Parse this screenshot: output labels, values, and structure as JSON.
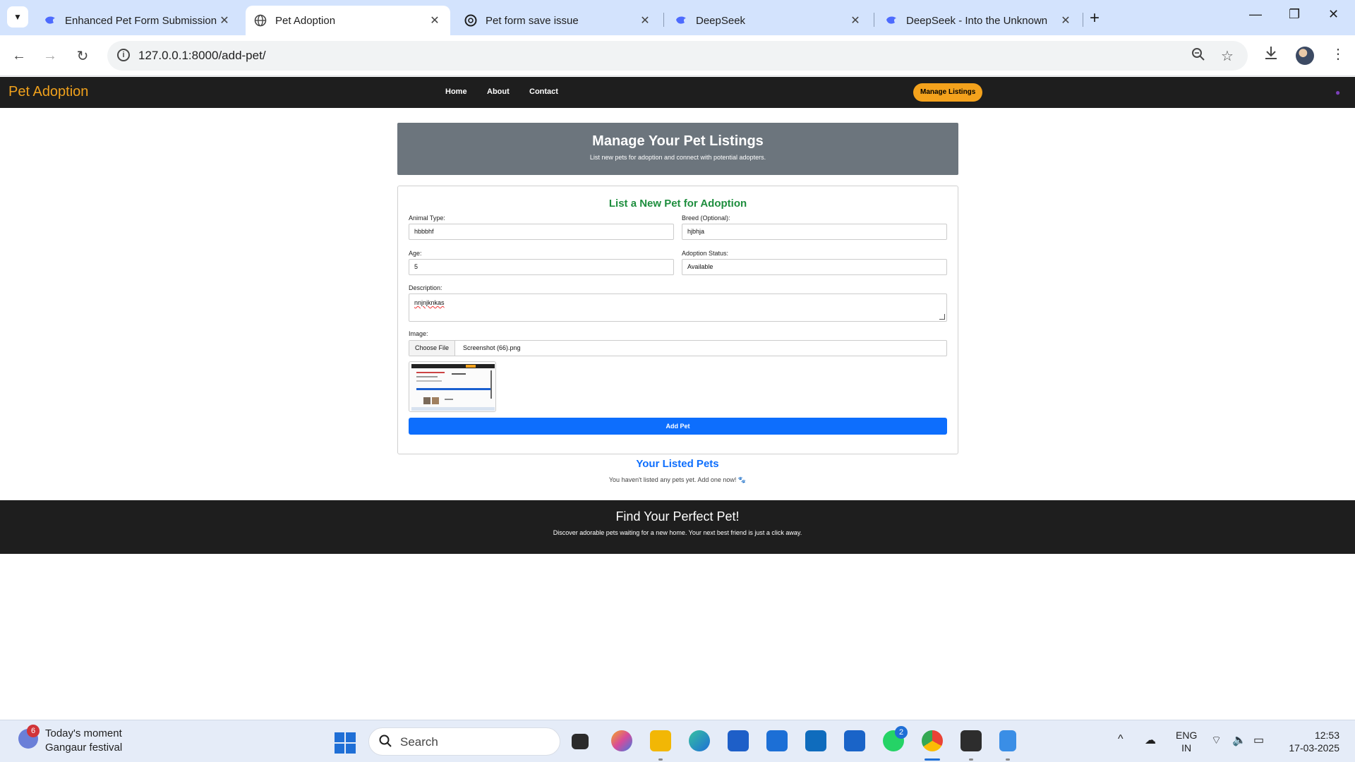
{
  "browser": {
    "tabs": [
      {
        "title": "Enhanced Pet Form Submission",
        "active": false,
        "icon": "deepseek-icon"
      },
      {
        "title": "Pet Adoption",
        "active": true,
        "icon": "globe-icon"
      },
      {
        "title": "Pet form save issue",
        "active": false,
        "icon": "chatgpt-icon"
      },
      {
        "title": "DeepSeek",
        "active": false,
        "icon": "deepseek-icon"
      },
      {
        "title": "DeepSeek - Into the Unknown",
        "active": false,
        "icon": "deepseek-icon"
      }
    ],
    "url": "127.0.0.1:8000/add-pet/"
  },
  "site": {
    "brand": "Pet Adoption",
    "nav": [
      "Home",
      "About",
      "Contact"
    ],
    "manage_button": "Manage Listings"
  },
  "hero": {
    "title": "Manage Your Pet Listings",
    "subtitle": "List new pets for adoption and connect with potential adopters."
  },
  "form": {
    "title": "List a New Pet for Adoption",
    "animal_type": {
      "label": "Animal Type:",
      "value": "hbbbhf"
    },
    "breed": {
      "label": "Breed (Optional):",
      "value": "hjbhja"
    },
    "age": {
      "label": "Age:",
      "value": "5"
    },
    "status": {
      "label": "Adoption Status:",
      "value": "Available"
    },
    "description": {
      "label": "Description:",
      "value": "nnjnjknkas"
    },
    "image": {
      "label": "Image:",
      "choose_label": "Choose File",
      "file_name": "Screenshot (66).png"
    },
    "submit_label": "Add Pet"
  },
  "listed": {
    "title": "Your Listed Pets",
    "empty_text": "You haven't listed any pets yet. Add one now! 🐾"
  },
  "footer": {
    "title": "Find Your Perfect Pet!",
    "text": "Discover adorable pets waiting for a new home. Your next best friend is just a click away."
  },
  "taskbar": {
    "moment_title": "Today's moment",
    "moment_subtitle": "Gangaur festival",
    "widget_badge": "6",
    "search_placeholder": "Search",
    "whatsapp_badge": "2",
    "lang_line1": "ENG",
    "lang_line2": "IN",
    "time": "12:53",
    "date": "17-03-2025"
  },
  "colors": {
    "brand": "#f0a11c",
    "form_title": "#1e8e3e",
    "primary": "#0d6efd",
    "hero_bg": "#6c757d",
    "nav_bg": "#1e1e1e"
  }
}
